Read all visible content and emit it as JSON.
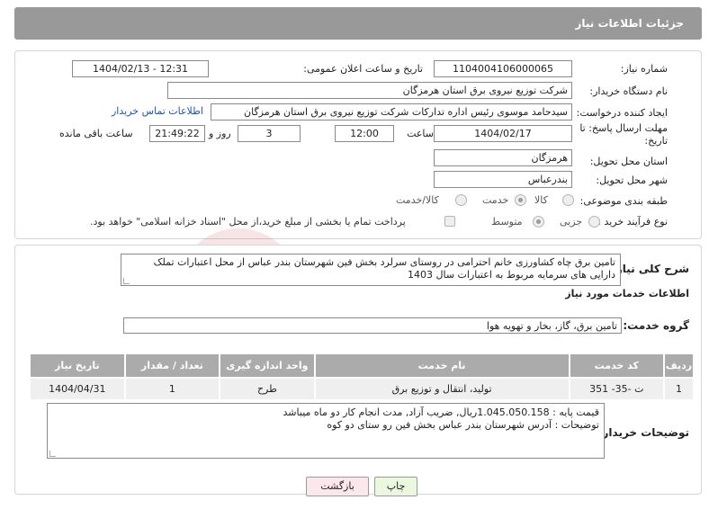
{
  "header": {
    "title": "جزئیات اطلاعات نیاز"
  },
  "form": {
    "need_number": {
      "label": "شماره نیاز:",
      "value": "1104004106000065"
    },
    "announce_datetime": {
      "label": "تاریخ و ساعت اعلان عمومی:",
      "value": "1404/02/13 - 12:31"
    },
    "buyer_org": {
      "label": "نام دستگاه خریدار:",
      "value": "شرکت توزیع نیروی برق استان هرمزگان"
    },
    "requester": {
      "label": "ایجاد کننده درخواست:",
      "value": "سیدحامد موسوی رئیس اداره تدارکات شرکت توزیع نیروی برق استان هرمزگان",
      "contact_link": "اطلاعات تماس خریدار"
    },
    "deadline": {
      "label": "مهلت ارسال پاسخ: تا تاریخ:",
      "date": "1404/02/17",
      "time_label": "ساعت",
      "time": "12:00",
      "days": "3",
      "days_label": "روز و",
      "remaining": "21:49:22",
      "remaining_label": "ساعت باقی مانده"
    },
    "province": {
      "label": "استان محل تحویل:",
      "value": "هرمزگان"
    },
    "city": {
      "label": "شهر محل تحویل:",
      "value": "بندرعباس"
    },
    "category": {
      "label": "طبقه بندی موضوعی:",
      "options": [
        "کالا",
        "خدمت",
        "کالا/خدمت"
      ],
      "selected": "خدمت"
    },
    "process": {
      "label": "نوع فرآیند خرید :",
      "options": [
        "جزیی",
        "متوسط"
      ],
      "selected": "متوسط",
      "payment_note": "پرداخت تمام یا بخشی از مبلغ خرید،از محل \"اسناد خزانه اسلامی\" خواهد بود."
    }
  },
  "description": {
    "label": "شرح کلی نیاز:",
    "text": "تامین برق چاه کشاورزی خانم احترامی در روستای سرلرد بخش فین شهرستان بندر عباس از محل اعتبارات تملک دارایی های سرمایه مربوط به اعتبارات سال 1403"
  },
  "services": {
    "section_title": "اطلاعات خدمات مورد نیاز",
    "group_label": "گروه خدمت:",
    "group_value": "تامین برق، گاز، بخار و تهویه هوا",
    "columns": [
      "ردیف",
      "کد خدمت",
      "نام خدمت",
      "واحد اندازه گیری",
      "تعداد / مقدار",
      "تاریخ نیاز"
    ],
    "rows": [
      [
        "1",
        "ت -35- 351",
        "تولید، انتقال و توزیع برق",
        "طرح",
        "1",
        "1404/04/31"
      ]
    ]
  },
  "buyer_notes": {
    "label": "توضیحات خریدار:",
    "line1": "قیمت پایه : 1.045.050.158ریال, ضریب آزاد, مدت انجام کار دو ماه میباشد",
    "line2": "توضیحات : آدرس شهرستان بندر عباس بخش فین رو ستای دو کوه"
  },
  "buttons": {
    "print": "چاپ",
    "back": "بازگشت"
  },
  "colors": {
    "header_bg": "#999999",
    "table_header_bg": "#ababab",
    "print_bg": "#eaf8df",
    "back_bg": "#fbe7ec",
    "link": "#1a55b5"
  }
}
